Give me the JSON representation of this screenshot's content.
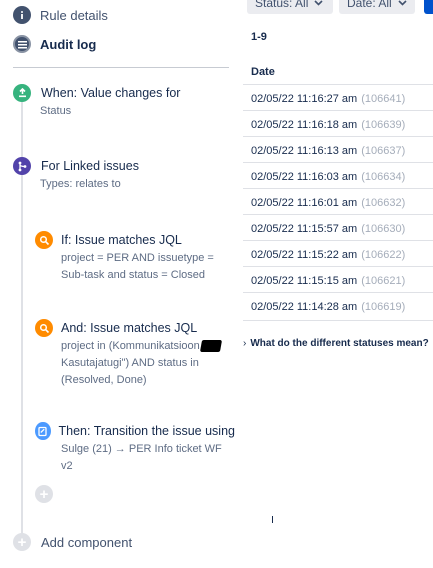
{
  "nav": {
    "rule_details": "Rule details",
    "audit_log": "Audit log"
  },
  "steps": {
    "when": {
      "title": "When: Value changes for",
      "desc": "Status"
    },
    "branch": {
      "title": "For Linked issues",
      "desc": "Types: relates to"
    },
    "if": {
      "title": "If: Issue matches JQL",
      "desc_lines": [
        "project = PER AND issuetype =",
        "Sub-task and status = Closed"
      ]
    },
    "and": {
      "title": "And: Issue matches JQL",
      "desc_lines": [
        "project in (Kommunikatsioon, \"",
        "Kasutajatugi\") AND status in",
        "(Resolved, Done)"
      ]
    },
    "then": {
      "title": "Then: Transition the issue using",
      "desc": "Sulge (21) → PER Info ticket WF v2"
    }
  },
  "add_component": "Add component",
  "filters": {
    "status": "Status: All",
    "date": "Date: All"
  },
  "range": "1-9",
  "table": {
    "header": "Date",
    "rows": [
      {
        "date": "02/05/22 11:16:27 am",
        "id": "(106641)"
      },
      {
        "date": "02/05/22 11:16:18 am",
        "id": "(106639)"
      },
      {
        "date": "02/05/22 11:16:13 am",
        "id": "(106637)"
      },
      {
        "date": "02/05/22 11:16:03 am",
        "id": "(106634)"
      },
      {
        "date": "02/05/22 11:16:01 am",
        "id": "(106632)"
      },
      {
        "date": "02/05/22 11:15:57 am",
        "id": "(106630)"
      },
      {
        "date": "02/05/22 11:15:22 am",
        "id": "(106622)"
      },
      {
        "date": "02/05/22 11:15:15 am",
        "id": "(106621)"
      },
      {
        "date": "02/05/22 11:14:28 am",
        "id": "(106619)"
      }
    ]
  },
  "statuses_link": "What do the different statuses mean?",
  "colors": {
    "when": "#36b37e",
    "branch": "#5243aa",
    "condition": "#ff8b00",
    "action": "#4c9aff",
    "primary": "#0052cc"
  },
  "icons": {
    "rule_details": "info-icon",
    "audit_log": "list-icon",
    "when": "trigger-icon",
    "branch": "branch-icon",
    "condition": "search-icon",
    "action": "edit-icon",
    "add": "plus-icon"
  }
}
